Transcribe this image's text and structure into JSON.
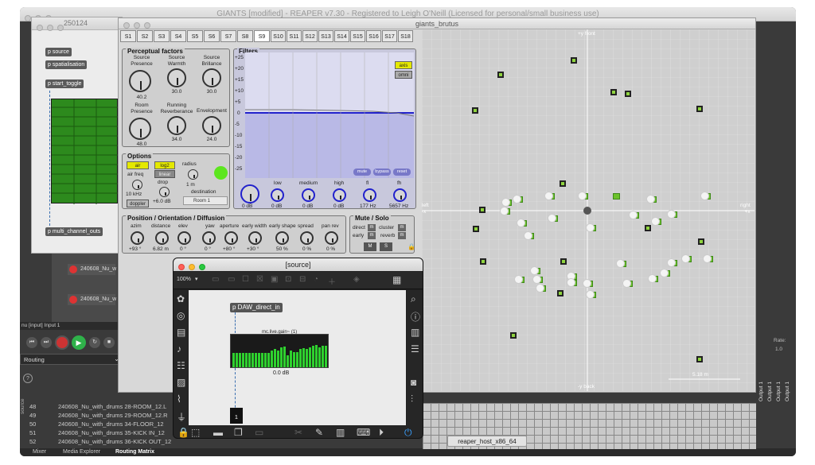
{
  "main_window": {
    "title": "GIANTS [modified] - REAPER v7.30 - Registered to Leigh O'Neill (Licensed for personal/small business use)"
  },
  "patcher_window": {
    "title": "250124",
    "objects": [
      "p source",
      "p spatialisation",
      "p start_toggle",
      "p multi_channel_outs"
    ]
  },
  "brutus": {
    "title": "giants_brutus",
    "tabs": [
      "S1",
      "S2",
      "S3",
      "S4",
      "S5",
      "S6",
      "S7",
      "S8",
      "S9",
      "S10",
      "S11",
      "S12",
      "S13",
      "S14",
      "S15",
      "S16",
      "S17",
      "S18"
    ],
    "active_tab": "S9",
    "perceptual": {
      "header": "Perceptual factors",
      "knobs": [
        {
          "label": "Source\nPresence",
          "value": "40.2"
        },
        {
          "label": "Source\nWarmth",
          "value": "30.0"
        },
        {
          "label": "Source\nBrillance",
          "value": "30.0"
        },
        {
          "label": "Room\nPresence",
          "value": "48.0"
        },
        {
          "label": "Running\nReverberance",
          "value": "34.0"
        },
        {
          "label": "Envelopment",
          "value": "24.0"
        }
      ]
    },
    "options": {
      "header": "Options",
      "air_label": "air",
      "log2_label": "log2",
      "linear_label": "linear",
      "radius_label": "radius",
      "radius_value": "1 m",
      "air_freq_label": "air freq",
      "air_freq_value": "10 kHz",
      "drop_label": "drop",
      "drop_value": "+6.0 dB",
      "doppler_label": "doppler",
      "destination_label": "destination",
      "destination_value": "Room 1"
    },
    "filters": {
      "header": "Filters",
      "y_ticks": [
        "+25",
        "+20",
        "+15",
        "+10",
        "+5",
        "0",
        "-5",
        "-10",
        "-15",
        "-20",
        "-25"
      ],
      "axis_label": "axis",
      "omni_label": "omni",
      "mute_label": "mute",
      "bypass_label": "bypass",
      "reset_label": "reset",
      "bands": [
        {
          "label": "",
          "value": "0 dB"
        },
        {
          "label": "low",
          "value": "0 dB"
        },
        {
          "label": "medium",
          "value": "0 dB"
        },
        {
          "label": "high",
          "value": "0 dB"
        },
        {
          "label": "fl",
          "value": "177 Hz"
        },
        {
          "label": "fh",
          "value": "5657 Hz"
        }
      ]
    },
    "position": {
      "header": "Position / Orientation / Diffusion",
      "params": [
        {
          "label": "azim",
          "value": "+93 °"
        },
        {
          "label": "distance",
          "value": "6.82 m"
        },
        {
          "label": "elev",
          "value": "0 °"
        },
        {
          "label": "yaw",
          "value": "0 °"
        },
        {
          "label": "aperture",
          "value": "+80 °"
        },
        {
          "label": "early width",
          "value": "+30 °"
        },
        {
          "label": "early shape",
          "value": "50 %"
        },
        {
          "label": "spread",
          "value": "0 %"
        },
        {
          "label": "pan rev",
          "value": "0 %"
        }
      ]
    },
    "mute_solo": {
      "header": "Mute / Solo",
      "direct": "direct",
      "early": "early",
      "cluster": "cluster",
      "reverb": "reverb",
      "m_label": "M",
      "s_label": "S",
      "btn_m": "m"
    },
    "spatial": {
      "front": "+y front",
      "back": "-y back",
      "left": "left\n-x",
      "right": "right\n+x",
      "scale": "5.18 m"
    }
  },
  "source_window": {
    "title": "[source]",
    "zoom": "100%",
    "object": "p DAW_direct_in",
    "meter_label": "mc.live.gain~ (1)",
    "meter_value": "0.0 dB",
    "outlet_number": "1"
  },
  "reaper": {
    "tracks": [
      {
        "name": "240608_Nu_w"
      },
      {
        "name": "240608_Nu_w"
      }
    ],
    "input_label": "nu [input] Input 1",
    "routing_label": "Routing",
    "help": "?",
    "routing_rows": [
      {
        "num": "48",
        "name": "240608_Nu_with_drums 28-ROOM_12.L"
      },
      {
        "num": "49",
        "name": "240608_Nu_with_drums 29-ROOM_12.R"
      },
      {
        "num": "50",
        "name": "240608_Nu_with_drums 34-FLOOR_12"
      },
      {
        "num": "51",
        "name": "240608_Nu_with_drums 35-KICK IN_12"
      },
      {
        "num": "52",
        "name": "240608_Nu_with_drums 36-KICK OUT_12"
      }
    ],
    "source_side": "source",
    "outputs": [
      "Output 1",
      "Output 1",
      "Output 1",
      "Output 1"
    ],
    "rate_label": "Rate:",
    "rate_value": "1.0",
    "bottom_tabs": [
      "Mixer",
      "Media Explorer",
      "Routing Matrix"
    ],
    "host_label": "reaper_host_x86_64"
  }
}
